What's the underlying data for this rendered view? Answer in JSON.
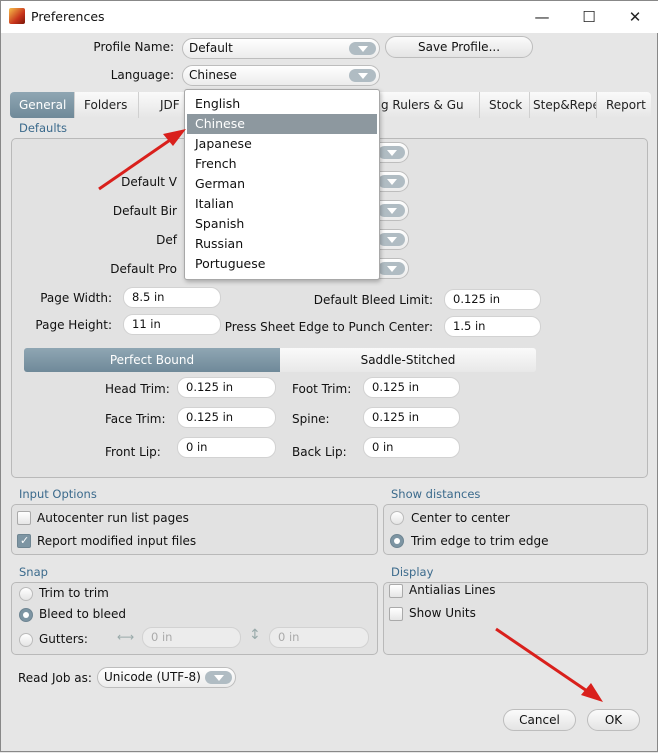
{
  "window": {
    "title": "Preferences",
    "minimize": "—",
    "maximize": "☐",
    "close": "✕"
  },
  "profile": {
    "label": "Profile Name:",
    "value": "Default",
    "save_label": "Save Profile..."
  },
  "language": {
    "label": "Language:",
    "value": "Chinese",
    "options": [
      "English",
      "Chinese",
      "Japanese",
      "French",
      "German",
      "Italian",
      "Spanish",
      "Russian",
      "Portuguese"
    ],
    "selected": "Chinese"
  },
  "tabs": [
    {
      "label": "General"
    },
    {
      "label": "Folders"
    },
    {
      "label": "JDF"
    },
    {
      "label": "g Rulers & Gu"
    },
    {
      "label": "Stock"
    },
    {
      "label": "Step&Repe"
    },
    {
      "label": "Report"
    }
  ],
  "defaults": {
    "title": "Defaults",
    "partial_labels": [
      "Default V",
      "Default Bir",
      "Def",
      "Default Pro"
    ],
    "page_width": {
      "label": "Page Width:",
      "value": "8.5 in"
    },
    "page_height": {
      "label": "Page Height:",
      "value": "11 in"
    },
    "bleed_limit": {
      "label": "Default Bleed Limit:",
      "value": "0.125 in"
    },
    "punch_center": {
      "label": "Press Sheet Edge to Punch Center:",
      "value": "1.5 in"
    },
    "binding_tabs": [
      "Perfect Bound",
      "Saddle-Stitched"
    ],
    "head_trim": {
      "label": "Head Trim:",
      "value": "0.125 in"
    },
    "foot_trim": {
      "label": "Foot Trim:",
      "value": "0.125 in"
    },
    "face_trim": {
      "label": "Face Trim:",
      "value": "0.125 in"
    },
    "spine": {
      "label": "Spine:",
      "value": "0.125 in"
    },
    "front_lip": {
      "label": "Front Lip:",
      "value": "0 in"
    },
    "back_lip": {
      "label": "Back Lip:",
      "value": "0 in"
    }
  },
  "input_options": {
    "title": "Input Options",
    "autocenter": {
      "label": "Autocenter run list pages",
      "checked": false
    },
    "report_modified": {
      "label": "Report modified input files",
      "checked": true
    }
  },
  "show_distances": {
    "title": "Show distances",
    "options": [
      "Center to center",
      "Trim edge to trim edge"
    ],
    "selected": "Trim edge to trim edge"
  },
  "snap": {
    "title": "Snap",
    "options": [
      "Trim to trim",
      "Bleed to bleed",
      "Gutters:"
    ],
    "selected": "Bleed to bleed",
    "gutter_h": "0 in",
    "gutter_v": "0 in"
  },
  "display": {
    "title": "Display",
    "antialias": {
      "label": "Antialias Lines",
      "checked": false
    },
    "show_units": {
      "label": "Show Units",
      "checked": false
    }
  },
  "read_job": {
    "label": "Read Job as:",
    "value": "Unicode (UTF-8)"
  },
  "buttons": {
    "cancel": "Cancel",
    "ok": "OK"
  },
  "colors": {
    "accent": "#7d95a3",
    "group_title": "#3b6a8c",
    "annotation_arrow": "#d9201c"
  }
}
